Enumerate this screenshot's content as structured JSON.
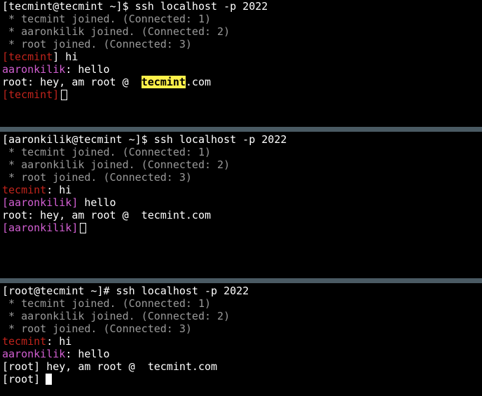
{
  "panes": [
    {
      "prompt": "[tecmint@tecmint ~]$ ssh localhost -p 2022",
      "join_lines": [
        " * tecmint joined. (Connected: 1)",
        " * aaronkilik joined. (Connected: 2)",
        " * root joined. (Connected: 3)"
      ],
      "msg1_user": "tecmint",
      "msg1_text": " hi",
      "msg2_user": "aaronkilik",
      "msg2_text": ": hello",
      "msg3_prefix": "root: hey, am root @  ",
      "msg3_highlight": "tecmint",
      "msg3_suffix": ".com",
      "input_user": "tecmint"
    },
    {
      "prompt": "[aaronkilik@tecmint ~]$ ssh localhost -p 2022",
      "join_lines": [
        " * tecmint joined. (Connected: 1)",
        " * aaronkilik joined. (Connected: 2)",
        " * root joined. (Connected: 3)"
      ],
      "msg1_user": "tecmint",
      "msg1_text": ": hi",
      "msg2_user": "aaronkilik",
      "msg2_text": " hello",
      "msg3_text": "root: hey, am root @  tecmint.com",
      "input_user": "aaronkilik"
    },
    {
      "prompt": "[root@tecmint ~]# ssh localhost -p 2022",
      "join_lines": [
        " * tecmint joined. (Connected: 1)",
        " * aaronkilik joined. (Connected: 2)",
        " * root joined. (Connected: 3)"
      ],
      "msg1_user": "tecmint",
      "msg1_text": ": hi",
      "msg2_user": "aaronkilik",
      "msg2_text": ": hello",
      "msg3_user": "root",
      "msg3_text": " hey, am root @  tecmint.com",
      "input_user": "root"
    }
  ],
  "symbols": {
    "open_bracket": "[",
    "close_bracket": "]"
  },
  "colors": {
    "background": "#000000",
    "divider": "#4a5a63",
    "muted": "#9a9a9a",
    "user_tecmint": "#c0241c",
    "user_aaronkilik": "#d25fd2",
    "highlight": "#fff14a"
  }
}
